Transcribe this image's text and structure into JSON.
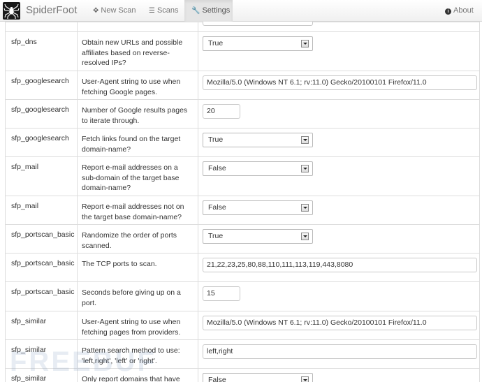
{
  "navbar": {
    "brand": "SpiderFoot",
    "new_scan": "New Scan",
    "scans": "Scans",
    "settings": "Settings",
    "about": "About"
  },
  "settings": [
    {
      "module": "sfp_dns",
      "description": "Obtain new URLs and possible affiliates based on reverse-resolved IPs?",
      "type": "select",
      "value": "True"
    },
    {
      "module": "sfp_googlesearch",
      "description": "User-Agent string to use when fetching Google pages.",
      "type": "text-long",
      "value": "Mozilla/5.0 (Windows NT 6.1; rv:11.0) Gecko/20100101 Firefox/11.0"
    },
    {
      "module": "sfp_googlesearch",
      "description": "Number of Google results pages to iterate through.",
      "type": "text-short",
      "value": "20"
    },
    {
      "module": "sfp_googlesearch",
      "description": "Fetch links found on the target domain-name?",
      "type": "select",
      "value": "True"
    },
    {
      "module": "sfp_mail",
      "description": "Report e-mail addresses on a sub-domain of the target base domain-name?",
      "type": "select",
      "value": "False"
    },
    {
      "module": "sfp_mail",
      "description": "Report e-mail addresses not on the target base domain-name?",
      "type": "select",
      "value": "False"
    },
    {
      "module": "sfp_portscan_basic",
      "description": "Randomize the order of ports scanned.",
      "type": "select",
      "value": "True"
    },
    {
      "module": "sfp_portscan_basic",
      "description": "The TCP ports to scan.",
      "type": "text-long",
      "value": "21,22,23,25,80,88,110,111,113,119,443,8080"
    },
    {
      "module": "sfp_portscan_basic",
      "description": "Seconds before giving up on a port.",
      "type": "text-short",
      "value": "15"
    },
    {
      "module": "sfp_similar",
      "description": "User-Agent string to use when fetching pages from providers.",
      "type": "text-long",
      "value": "Mozilla/5.0 (Windows NT 6.1; rv:11.0) Gecko/20100101 Firefox/11.0"
    },
    {
      "module": "sfp_similar",
      "description": "Pattern search method to use: 'left,right', 'left' or 'right'.",
      "type": "text-long",
      "value": "left,right"
    },
    {
      "module": "sfp_similar",
      "description": "Only report domains that have",
      "type": "select",
      "value": "False"
    }
  ],
  "watermark": "FREEBUF"
}
